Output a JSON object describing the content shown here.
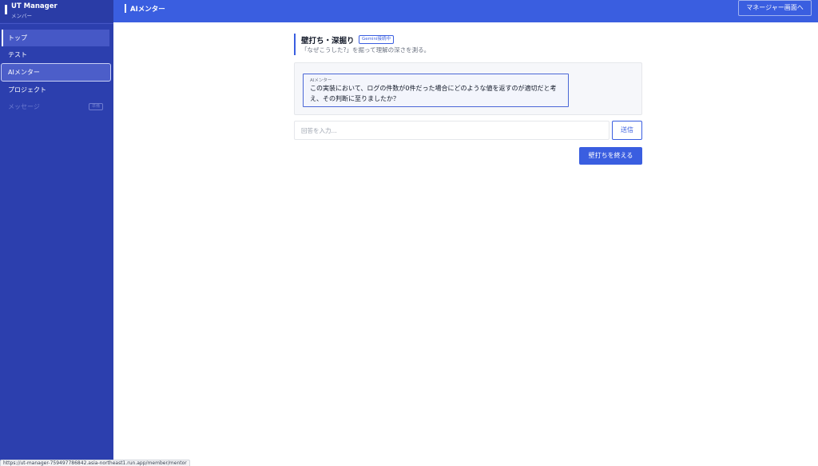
{
  "sidebar": {
    "app_title": "UT Manager",
    "role": "メンバー",
    "items": [
      {
        "label": "トップ"
      },
      {
        "label": "テスト"
      },
      {
        "label": "AIメンター"
      },
      {
        "label": "プロジェクト"
      },
      {
        "label": "メッセージ",
        "badge": "準備"
      }
    ]
  },
  "header": {
    "title": "AIメンター",
    "manager_button": "マネージャー画面へ"
  },
  "main": {
    "section_title": "壁打ち・深掘り",
    "gemini_badge": "Gemini接続中",
    "section_subtitle": "「なぜこうした?」を掘って理解の深さを測る。",
    "message": {
      "from": "AIメンター",
      "text": "この実装において、ログの件数が0件だった場合にどのような値を返すのが適切だと考え、その判断に至りましたか？"
    },
    "answer_placeholder": "回答を入力...",
    "send_button": "送信",
    "finish_button": "壁打ちを終える"
  },
  "status_bar": {
    "url": "https://ut-manager-759497786842.asia-northeast1.run.app/member/mentor"
  }
}
